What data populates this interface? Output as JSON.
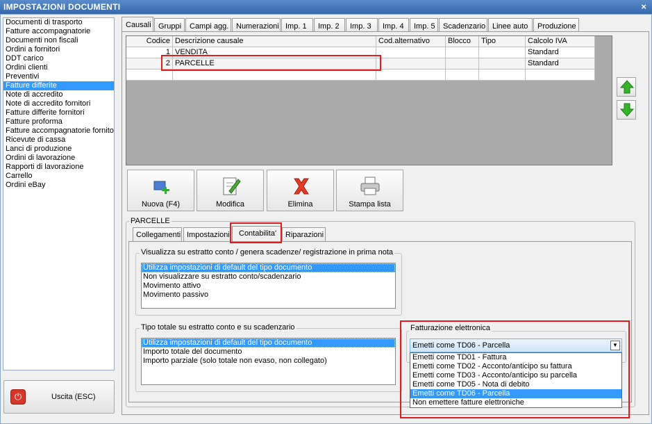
{
  "window": {
    "title": "IMPOSTAZIONI DOCUMENTI",
    "close": "×"
  },
  "doclist": [
    "Documenti di trasporto",
    "Fatture accompagnatorie",
    "Documenti non fiscali",
    "Ordini a fornitori",
    "DDT carico",
    "Ordini clienti",
    "Preventivi",
    "Fatture differite",
    "Note di accredito",
    "Note di accredito fornitori",
    "Fatture differite fornitori",
    "Fatture proforma",
    "Fatture accompagnatorie fornito",
    "Ricevute di cassa",
    "Lanci di produzione",
    "Ordini di lavorazione",
    "Rapporti di lavorazione",
    "Carrello",
    "Ordini eBay"
  ],
  "doclist_selected": "Fatture differite",
  "exit": {
    "label": "Uscita (ESC)",
    "icon": "power-icon"
  },
  "tabs": [
    "Causali",
    "Gruppi",
    "Campi agg.",
    "Numerazioni",
    "Imp. 1",
    "Imp. 2",
    "Imp. 3",
    "Imp. 4",
    "Imp. 5",
    "Scadenzario",
    "Linee auto",
    "Produzione"
  ],
  "grid": {
    "headers": [
      "Codice",
      "Descrizione causale",
      "Cod.alternativo",
      "Blocco",
      "Tipo",
      "Calcolo IVA"
    ],
    "rows": [
      [
        "1",
        "VENDITA",
        "",
        "",
        "",
        "Standard"
      ],
      [
        "2",
        "PARCELLE",
        "",
        "",
        "",
        "Standard"
      ]
    ]
  },
  "arrows": {
    "up": "arrow-up-icon",
    "down": "arrow-down-icon"
  },
  "actions": [
    {
      "label": "Nuova (F4)",
      "icon": "new-icon"
    },
    {
      "label": "Modifica",
      "icon": "edit-icon"
    },
    {
      "label": "Elimina",
      "icon": "delete-icon"
    },
    {
      "label": "Stampa lista",
      "icon": "printer-icon"
    }
  ],
  "group_title": "PARCELLE",
  "subtabs": [
    "Collegamenti",
    "Impostazioni",
    "Contabilita'",
    "Riparazioni"
  ],
  "visualizza": {
    "title": "Visualizza su estratto conto / genera scadenze/ registrazione  in prima nota",
    "items": [
      "Utilizza impostazioni di default del tipo documento",
      "Non visualizzare su estratto conto/scadenzario",
      "Movimento attivo",
      "Movimento passivo"
    ]
  },
  "tipo_totale": {
    "title": "Tipo totale su estratto conto e su scadenzario",
    "items": [
      "Utilizza impostazioni di default del tipo documento",
      "Importo totale del documento",
      "Importo parziale (solo totale non evaso, non collegato)"
    ]
  },
  "fatturazione": {
    "title": "Fatturazione elettronica",
    "value": "Emetti come TD06 - Parcella",
    "options": [
      "Emetti come TD01 - Fattura",
      "Emetti come TD02 - Acconto/anticipo su fattura",
      "Emetti come TD03 - Acconto/anticipo su parcella",
      "Emetti come TD05 - Nota di debito",
      "Emetti come TD06 - Parcella",
      "Non emettere fatture elettroniche"
    ]
  },
  "colors": {
    "selection": "#3399ff",
    "highlight": "#e01c1c",
    "titlebar": "#3567ad"
  }
}
